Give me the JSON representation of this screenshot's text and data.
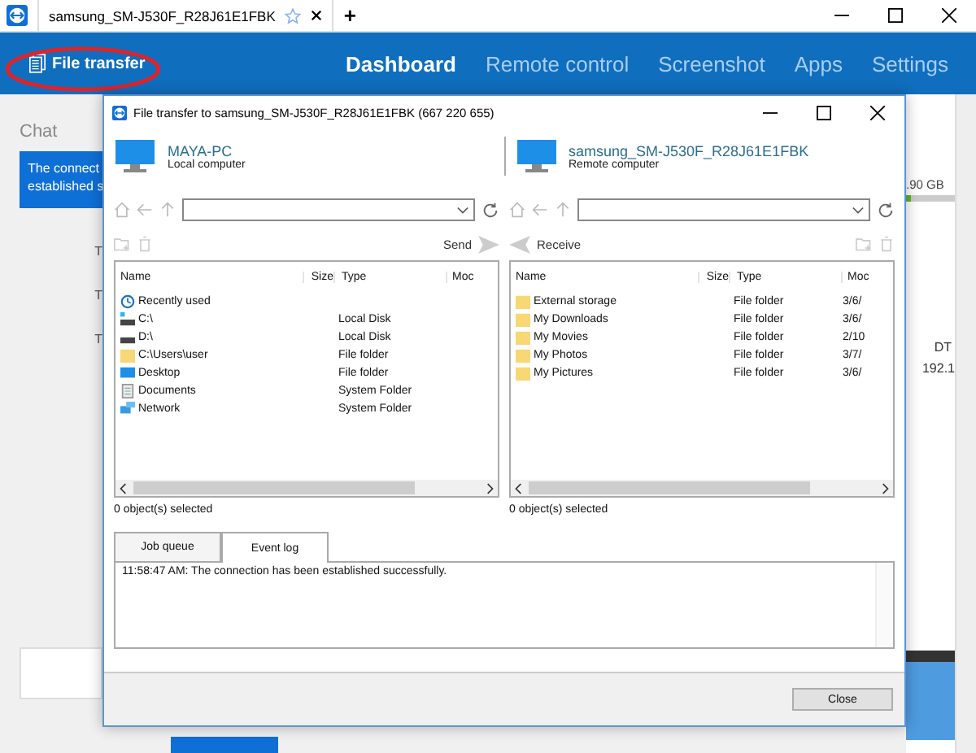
{
  "tab_bar": {
    "tab_title": "samsung_SM-J530F_R28J61E1FBK",
    "add_tab": "+"
  },
  "header": {
    "file_transfer": "File transfer",
    "nav": [
      {
        "label": "Dashboard",
        "selected": true
      },
      {
        "label": "Remote control",
        "selected": false
      },
      {
        "label": "Screenshot",
        "selected": false
      },
      {
        "label": "Apps",
        "selected": false
      },
      {
        "label": "Settings",
        "selected": false
      }
    ]
  },
  "background": {
    "chat_title": "Chat",
    "chat_bubble": [
      "The connect",
      "established s"
    ],
    "row_letters": [
      "T",
      "T",
      "T"
    ],
    "storage": ".90 GB",
    "storage_bar": {
      "level": 0.1
    },
    "device_type": "DT",
    "ip": "192.1"
  },
  "dialog": {
    "title": "File transfer to samsung_SM-J530F_R28J61E1FBK (667 220 655)",
    "computers": [
      {
        "name": "MAYA-PC",
        "role": "Local computer"
      },
      {
        "name": "samsung_SM-J530F_R28J61E1FBK",
        "role": "Remote computer"
      }
    ],
    "panes": [
      {
        "action": "Send",
        "columns": [
          "Name",
          "Size",
          "Type",
          "Moc"
        ],
        "status": "0 object(s) selected",
        "rows": [
          {
            "kind": "recent",
            "name": "Recently used",
            "type": "",
            "modified": ""
          },
          {
            "kind": "system-drive",
            "name": "C:\\",
            "type": "Local Disk",
            "modified": ""
          },
          {
            "kind": "drive",
            "name": "D:\\",
            "type": "Local Disk",
            "modified": ""
          },
          {
            "kind": "folder",
            "name": "C:\\Users\\user",
            "type": "File folder",
            "modified": ""
          },
          {
            "kind": "desktop",
            "name": "Desktop",
            "type": "File folder",
            "modified": ""
          },
          {
            "kind": "documents",
            "name": "Documents",
            "type": "System Folder",
            "modified": ""
          },
          {
            "kind": "network",
            "name": "Network",
            "type": "System Folder",
            "modified": ""
          }
        ]
      },
      {
        "action": "Receive",
        "columns": [
          "Name",
          "Size",
          "Type",
          "Moc"
        ],
        "status": "0 object(s) selected",
        "rows": [
          {
            "kind": "folder",
            "name": "External storage",
            "type": "File folder",
            "modified": "3/6/"
          },
          {
            "kind": "folder",
            "name": "My Downloads",
            "type": "File folder",
            "modified": "3/6/"
          },
          {
            "kind": "folder",
            "name": "My Movies",
            "type": "File folder",
            "modified": "2/10"
          },
          {
            "kind": "folder",
            "name": "My Photos",
            "type": "File folder",
            "modified": "3/7/"
          },
          {
            "kind": "folder",
            "name": "My Pictures",
            "type": "File folder",
            "modified": "3/6/"
          }
        ]
      }
    ],
    "tabs": [
      {
        "label": "Job queue",
        "selected": false
      },
      {
        "label": "Event log",
        "selected": true
      }
    ],
    "log": [
      "11:58:47 AM: The connection has been established successfully."
    ],
    "close_button": "Close"
  }
}
